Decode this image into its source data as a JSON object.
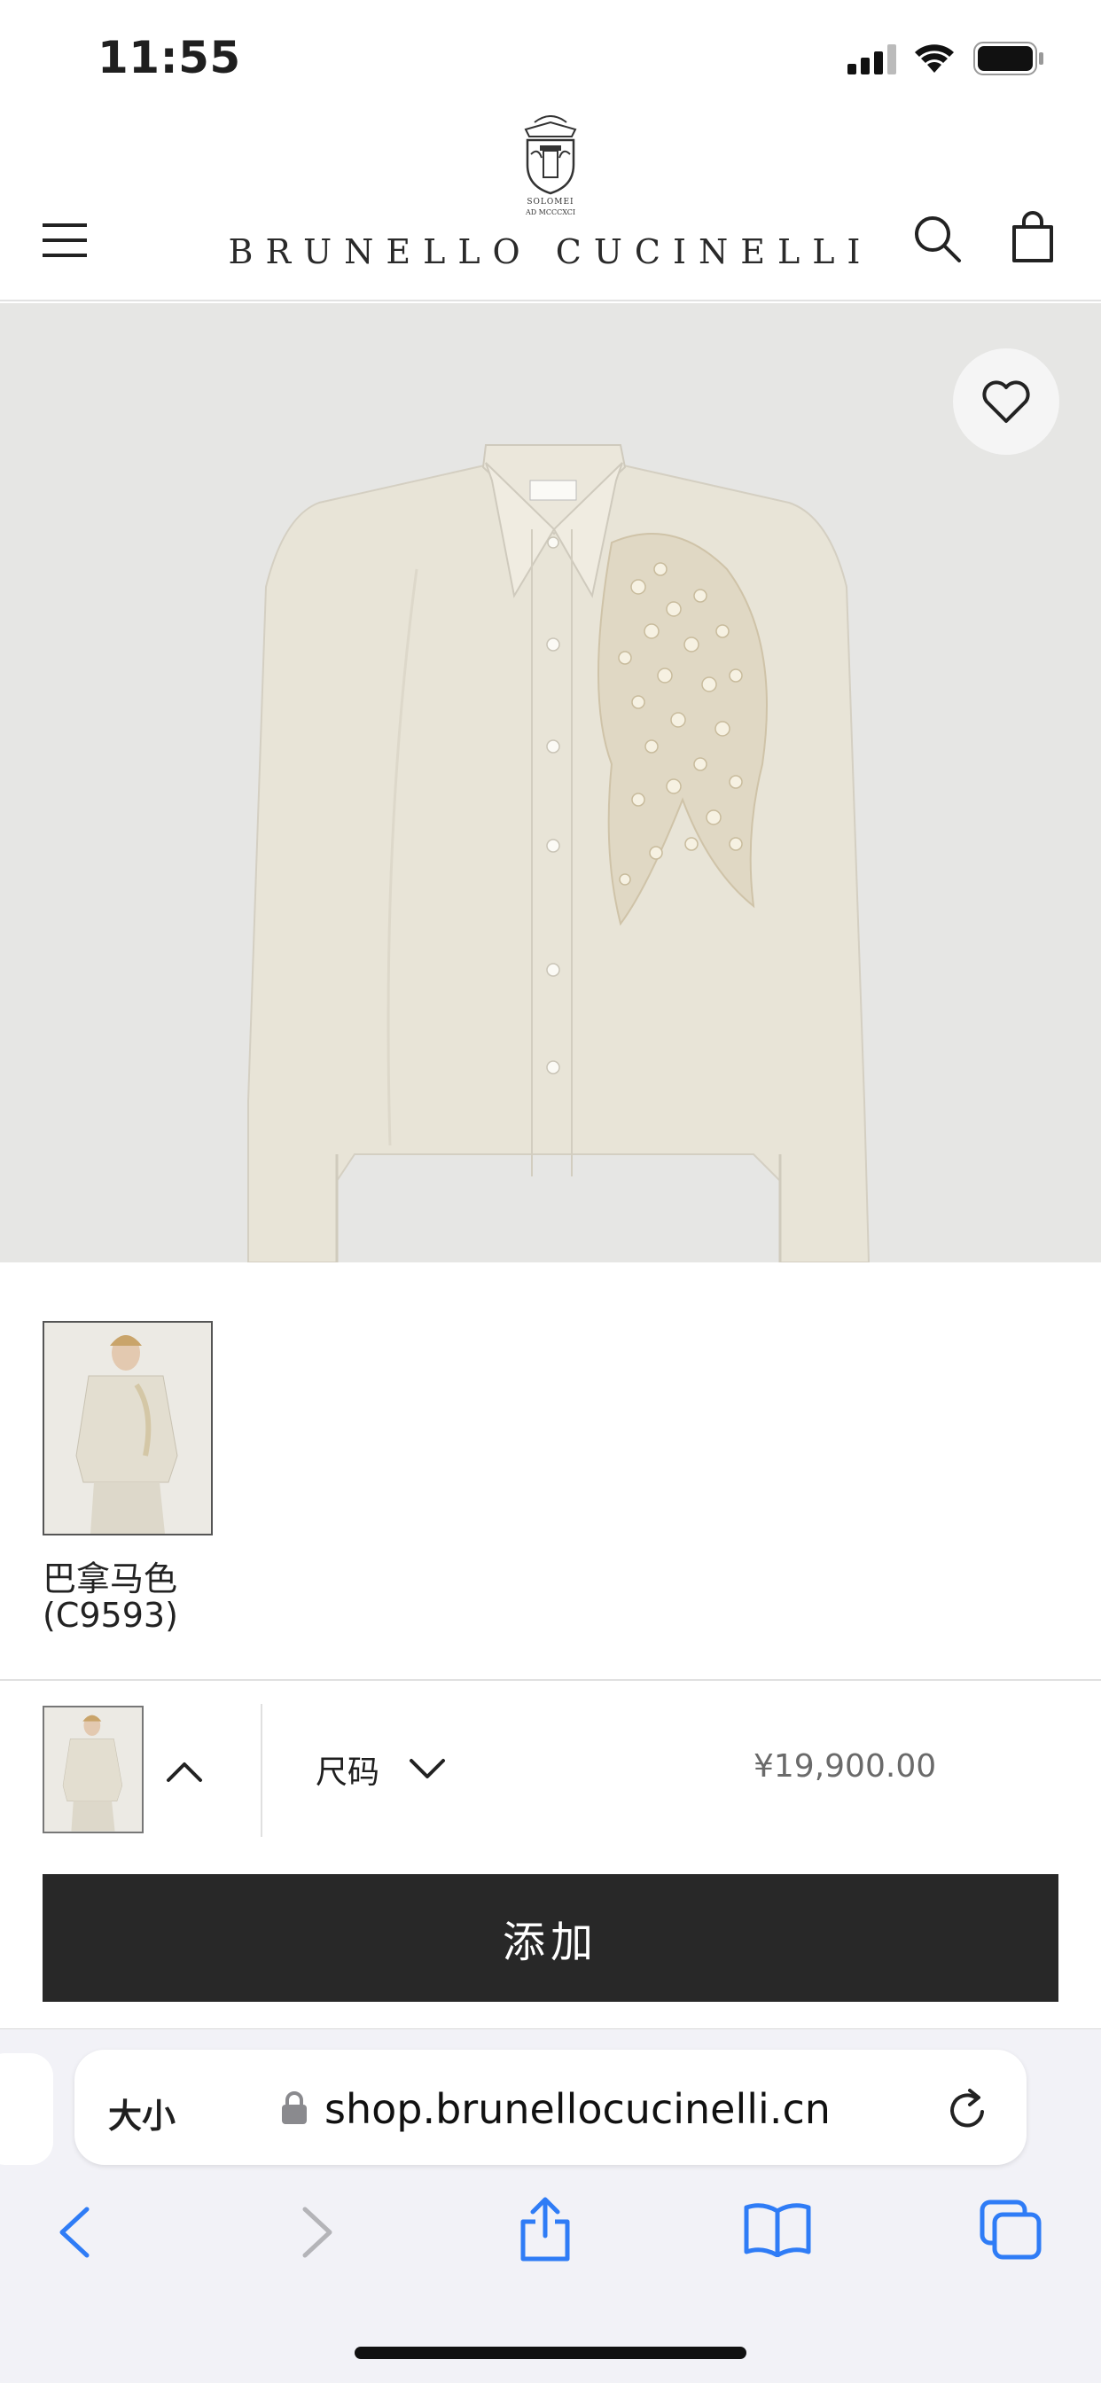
{
  "status_bar": {
    "time": "11:55"
  },
  "header": {
    "brand": "BRUNELLO CUCINELLI",
    "logo_caption_1": "SOLOMEI",
    "logo_caption_2": "AD MCCCXCI"
  },
  "product": {
    "swatch_label_line1": "巴拿马色",
    "swatch_label_line2": "(C9593)",
    "size_label": "尺码",
    "price": "¥19,900.00",
    "add_button": "添加"
  },
  "browser": {
    "text_size_label": "大小",
    "url": "shop.brunellocucinelli.cn"
  },
  "colors": {
    "accent_blue": "#2f7cf6",
    "button_dark": "#282828",
    "hero_bg": "#e6e6e4"
  }
}
